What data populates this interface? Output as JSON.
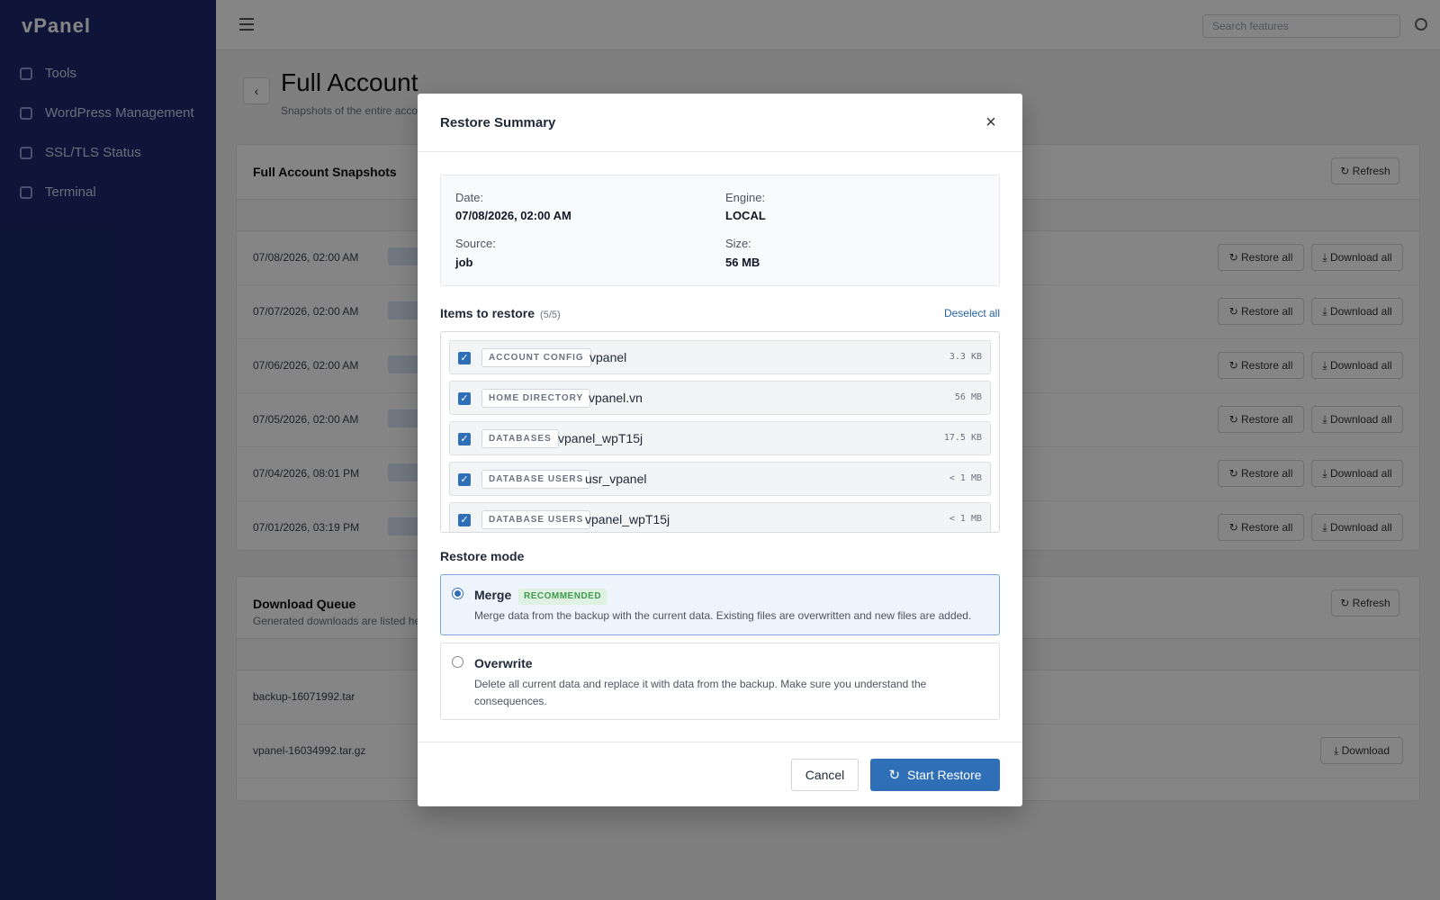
{
  "background": {
    "logo": "vPanel",
    "nav": [
      {
        "label": "Tools"
      },
      {
        "label": "WordPress Management"
      },
      {
        "label": "SSL/TLS Status"
      },
      {
        "label": "Terminal"
      }
    ],
    "search_placeholder": "Search features",
    "page_title": "Full Account",
    "page_subtitle": "Snapshots of the entire account",
    "snapshots_title": "Full Account Snapshots",
    "refresh_label": "↻ Refresh",
    "snapshot_dates": [
      "07/08/2026, 02:00 AM",
      "07/07/2026, 02:00 AM",
      "07/06/2026, 02:00 AM",
      "07/05/2026, 02:00 AM",
      "07/04/2026, 08:01 PM",
      "07/01/2026, 03:19 PM"
    ],
    "restore_all_label": "↻ Restore all",
    "download_all_label": "⤓ Download all",
    "queue_title": "Download Queue",
    "queue_subtitle": "Generated downloads are listed here",
    "queue_files": [
      "backup-16071992.tar",
      "vpanel-16034992.tar.gz"
    ],
    "download_label": "⤓ Download"
  },
  "modal": {
    "title": "Restore Summary",
    "close_icon": "×",
    "info": {
      "date_label": "Date:",
      "date_value": "07/08/2026, 02:00 AM",
      "engine_label": "Engine:",
      "engine_value": "LOCAL",
      "source_label": "Source:",
      "source_value": "job",
      "size_label": "Size:",
      "size_value": "56 MB"
    },
    "items_heading": "Items to restore",
    "items_count": "(5/5)",
    "deselect_all": "Deselect all",
    "items": [
      {
        "tag": "ACCOUNT CONFIG",
        "name": "vpanel",
        "size": "3.3 KB",
        "checked": true
      },
      {
        "tag": "HOME DIRECTORY",
        "name": "vpanel.vn",
        "size": "56 MB",
        "checked": true
      },
      {
        "tag": "DATABASES",
        "name": "vpanel_wpT15j",
        "size": "17.5 KB",
        "checked": true
      },
      {
        "tag": "DATABASE USERS",
        "name": "usr_vpanel",
        "size": "< 1 MB",
        "checked": true
      },
      {
        "tag": "DATABASE USERS",
        "name": "vpanel_wpT15j",
        "size": "< 1 MB",
        "checked": true
      }
    ],
    "mode_heading": "Restore mode",
    "modes": {
      "merge": {
        "name": "Merge",
        "badge": "RECOMMENDED",
        "desc": "Merge data from the backup with the current data. Existing files are overwritten and new files are added.",
        "selected": true
      },
      "overwrite": {
        "name": "Overwrite",
        "desc": "Delete all current data and replace it with data from the backup. Make sure you understand the consequences.",
        "selected": false
      }
    },
    "cancel_label": "Cancel",
    "start_label": "Start Restore",
    "start_icon": "↻",
    "accent_color": "#2f6fb8"
  }
}
